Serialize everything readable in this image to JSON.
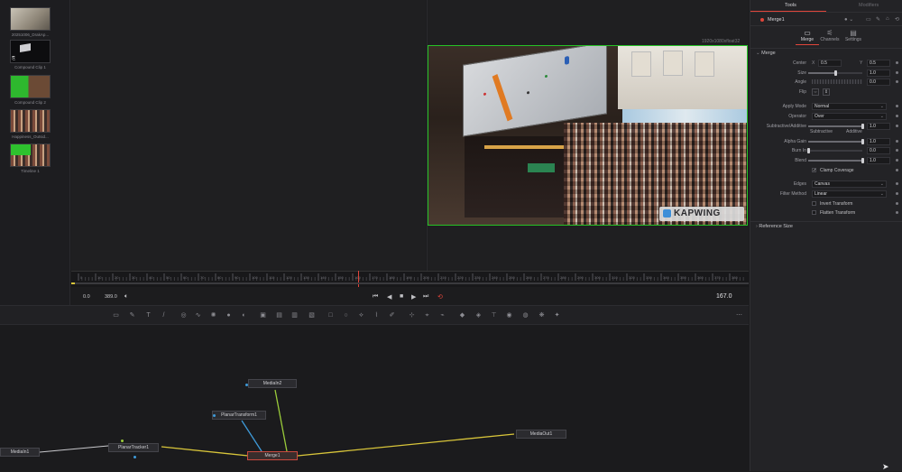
{
  "media_pool": {
    "clips": [
      {
        "label": "20251006_DrakAp...",
        "thumb": "beige"
      },
      {
        "label": "Compound Clip 1",
        "thumb": "dark"
      },
      {
        "label": "Compound Clip 2",
        "thumb": "green"
      },
      {
        "label": "Happiness_Outsid...",
        "thumb": "crowd"
      },
      {
        "label": "Timeline 1",
        "thumb": "green-crowd"
      }
    ]
  },
  "viewer": {
    "resolution_label": "1920x1080xfloat32",
    "watermark": "KAPWING"
  },
  "timeline": {
    "ruler_ticks": [
      "0",
      "10",
      "20",
      "30",
      "40",
      "50",
      "60",
      "70",
      "80",
      "90",
      "100",
      "110",
      "120",
      "130",
      "140",
      "150",
      "160",
      "170",
      "180",
      "190",
      "200",
      "210",
      "220",
      "230",
      "240",
      "250",
      "260",
      "270",
      "280",
      "290",
      "300",
      "310",
      "320",
      "330",
      "340",
      "350",
      "360",
      "370",
      "380"
    ],
    "start_time": "0.0",
    "end_time": "389.0",
    "current_time": "167.0"
  },
  "nodes": {
    "media_in_2": "MediaIn2",
    "planar_transform": "PlanarTransform1",
    "media_in_1": "MediaIn1",
    "planar_tracker": "PlanarTracker1",
    "merge": "Merge1",
    "media_out": "MediaOut1"
  },
  "inspector": {
    "tabs": {
      "tools": "Tools",
      "modifiers": "Modifiers"
    },
    "node_name": "Merge1",
    "sub_tabs": [
      "Merge",
      "Channels",
      "Settings"
    ],
    "section_merge": "Merge",
    "center": {
      "label": "Center",
      "x_label": "X",
      "x": "0.5",
      "y_label": "Y",
      "y": "0.5"
    },
    "size": {
      "label": "Size",
      "value": "1.0",
      "fraction": 0.5
    },
    "angle": {
      "label": "Angle",
      "value": "0.0"
    },
    "flip": {
      "label": "Flip"
    },
    "apply_mode": {
      "label": "Apply Mode",
      "value": "Normal"
    },
    "operator": {
      "label": "Operator",
      "value": "Over"
    },
    "subtractive_additive": {
      "label": "Subtractive/Additive",
      "value": "1.0",
      "fraction": 1.0,
      "left": "Subtractive",
      "right": "Additive"
    },
    "alpha_gain": {
      "label": "Alpha Gain",
      "value": "1.0",
      "fraction": 1.0
    },
    "burn_in": {
      "label": "Burn In",
      "value": "0.0",
      "fraction": 0.0
    },
    "blend": {
      "label": "Blend",
      "value": "1.0",
      "fraction": 1.0
    },
    "clamp_coverage": {
      "label": "Clamp Coverage",
      "checked": true
    },
    "edges": {
      "label": "Edges",
      "value": "Canvas"
    },
    "filter_method": {
      "label": "Filter Method",
      "value": "Linear"
    },
    "invert_transform": {
      "label": "Invert Transform",
      "checked": false
    },
    "flatten_transform": {
      "label": "Flatten Transform",
      "checked": false
    },
    "section_reference": "Reference Size"
  },
  "colors": {
    "accent_red": "#ca4a3e",
    "viewer_border": "#25c225",
    "wire_yellow": "#d8c53a",
    "wire_blue": "#3e9ad8",
    "wire_green": "#9acb3a"
  }
}
